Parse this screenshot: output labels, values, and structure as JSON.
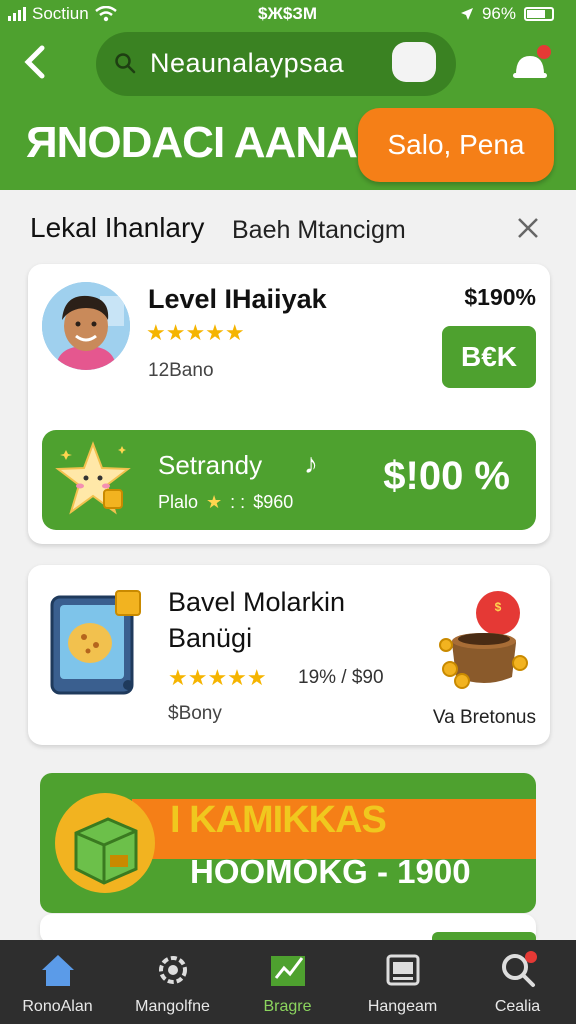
{
  "status_bar": {
    "carrier": "Soctiun",
    "time": "$Ж$ЗМ",
    "battery": "96%"
  },
  "header": {
    "search_placeholder": "Neaunalaypsaa",
    "brand": "ЯNODACI AANAN",
    "promo_button": "Salo, Pena"
  },
  "filter": {
    "title": "Lekal Ihanlary",
    "tag": "Baeh Mtancigm"
  },
  "card1": {
    "name": "Level IHaiiyak",
    "stars": "★★★★★",
    "subtitle": "12Bano",
    "price": "$190%",
    "button": "B€K",
    "promo": {
      "title": "Setrandy",
      "note": "♪",
      "sub_label": "Plalo",
      "sub_star": "★",
      "sub_sep": ": :",
      "sub_price": "$960",
      "price": "$!00 %"
    }
  },
  "card2": {
    "title_line1": "Bavel Molarkin",
    "title_line2": "Banügi",
    "stars": "★★★★★",
    "stats": "19% / $90",
    "subtitle": "$Bony",
    "bonus_label": "Va Bretonus"
  },
  "banner": {
    "line1": "I KAMIKKAS",
    "line2": "HOOMOKG - 1900"
  },
  "tabs": [
    {
      "label": "RonoAlan",
      "icon": "home-icon"
    },
    {
      "label": "Mangolfne",
      "icon": "gear-icon"
    },
    {
      "label": "Bragre",
      "icon": "chart-icon"
    },
    {
      "label": "Hangeam",
      "icon": "card-icon"
    },
    {
      "label": "Cealia",
      "icon": "search-icon"
    }
  ],
  "colors": {
    "primary_green": "#4ea12f",
    "accent_orange": "#f57f17",
    "tab_bar": "#2e2e2e"
  }
}
